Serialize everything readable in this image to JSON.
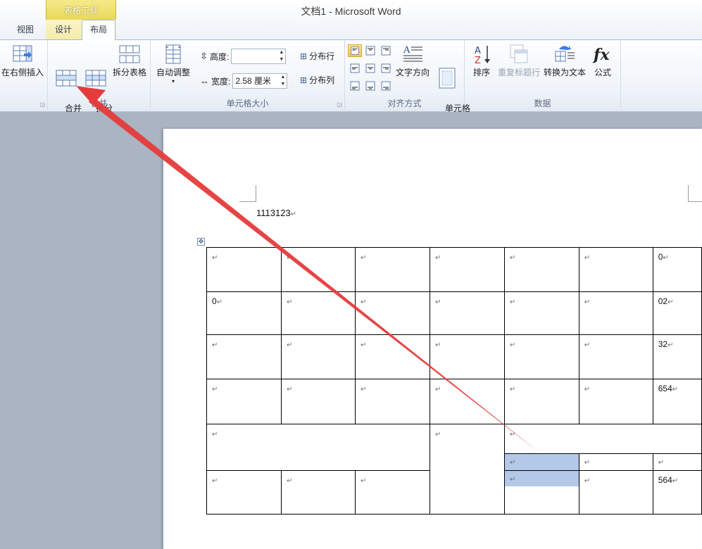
{
  "window": {
    "title": "文档1  -  Microsoft Word",
    "context_group": "表格工具",
    "tabs": [
      "视图",
      "设计",
      "布局"
    ],
    "active_tab": "布局",
    "context_color": "#e9d85b"
  },
  "ribbon": {
    "rows_columns": {
      "insert_right": "在右侧插入"
    },
    "merge": {
      "label": "合并",
      "merge_cells": "合并\n单元格",
      "split_cells": "拆分\n单元格",
      "split_table": "拆分表格"
    },
    "cell_size": {
      "label": "单元格大小",
      "autofit": "自动调整",
      "height_label": "高度:",
      "height_value": "",
      "width_label": "宽度:",
      "width_value": "2.58 厘米",
      "distribute_rows": "分布行",
      "distribute_cols": "分布列"
    },
    "alignment": {
      "label": "对齐方式",
      "text_direction": "文字方向",
      "cell_margins": "单元格\n边距"
    },
    "data": {
      "label": "数据",
      "sort": "排序",
      "repeat_header": "重复标题行",
      "convert_to_text": "转换为文本",
      "formula": "公式"
    }
  },
  "document": {
    "first_line": "1113123",
    "para_mark": "↵",
    "table": {
      "rows": [
        [
          "",
          "",
          "",
          "",
          "",
          "",
          "0"
        ],
        [
          "0",
          "",
          "",
          "",
          "",
          "",
          "02"
        ],
        [
          "",
          "",
          "",
          "",
          "",
          "",
          "32"
        ],
        [
          "",
          "",
          "",
          "",
          "",
          "",
          "654"
        ]
      ],
      "merged_row5_left": "",
      "row6_last": "564"
    }
  },
  "colors": {
    "ribbon_bg": "#eef3f9",
    "doc_bg": "#abb4c3",
    "selection": "#b4c8e8",
    "annotation_arrow": "#e53b3b"
  }
}
